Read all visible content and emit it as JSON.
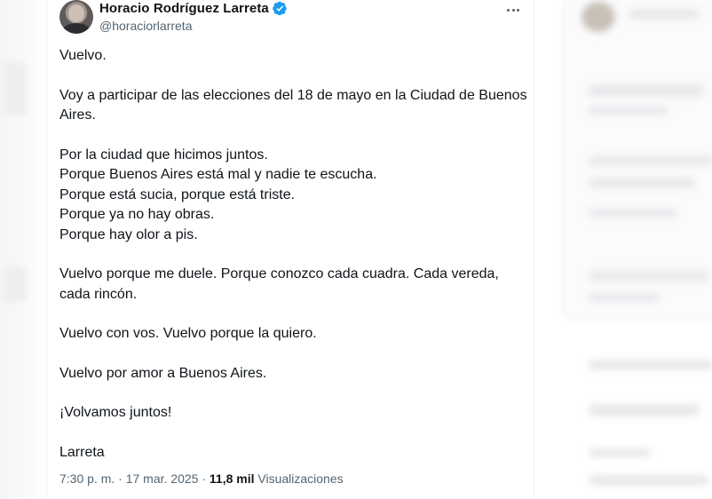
{
  "author": {
    "display_name": "Horacio Rodríguez Larreta",
    "handle": "@horaciorlarreta"
  },
  "tweet": {
    "paragraphs": [
      [
        "Vuelvo."
      ],
      [
        "Voy a participar de las elecciones del 18 de mayo en la Ciudad de Buenos",
        "Aires."
      ],
      [
        "Por la ciudad que hicimos juntos.",
        "Porque Buenos Aires está mal y nadie te escucha.",
        "Porque está sucia, porque está triste.",
        "Porque ya no hay obras.",
        "Porque hay olor a pis."
      ],
      [
        "Vuelvo porque me duele. Porque conozco cada cuadra. Cada vereda,",
        "cada rincón."
      ],
      [
        "Vuelvo con vos. Vuelvo porque la quiero."
      ],
      [
        "Vuelvo por amor a Buenos Aires."
      ],
      [
        "¡Volvamos juntos!"
      ],
      [
        "Larreta"
      ]
    ]
  },
  "meta": {
    "time": "7:30 p. m.",
    "separator": " · ",
    "date": "17 mar. 2025",
    "views_count": "11,8 mil",
    "views_label": "Visualizaciones"
  },
  "icons": {
    "verified": "verified-badge-icon",
    "more": "more-options-icon"
  },
  "colors": {
    "text": "#0f1419",
    "secondary": "#536471",
    "verified": "#1d9bf0"
  }
}
